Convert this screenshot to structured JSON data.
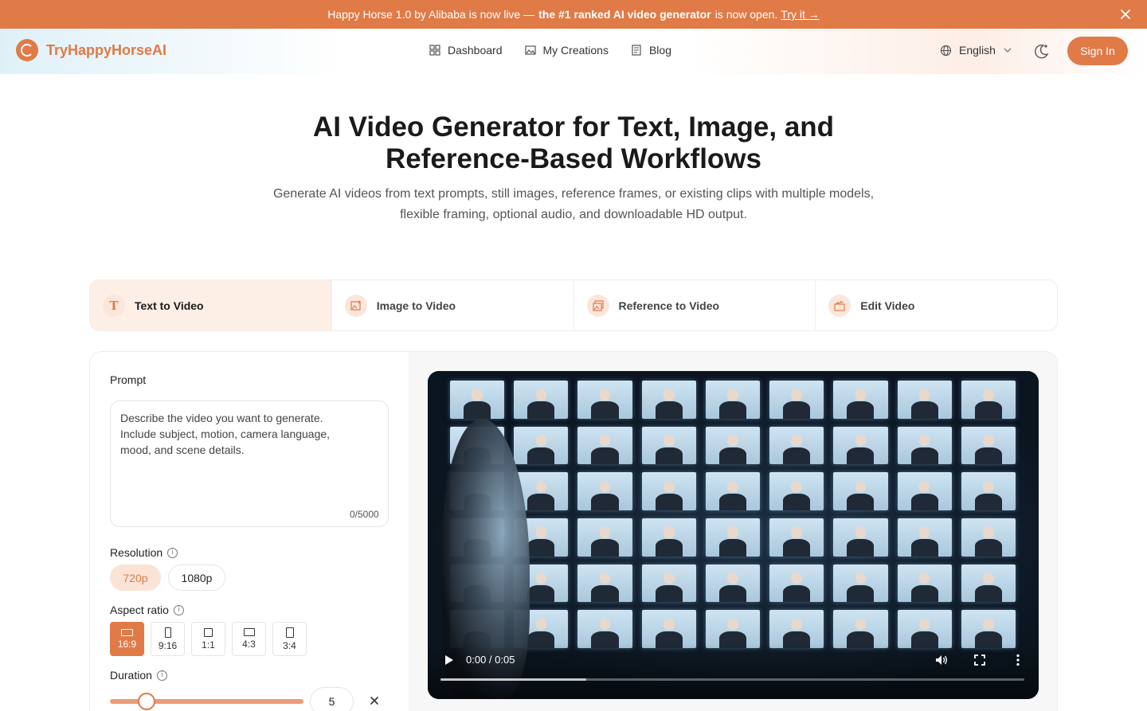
{
  "announcement": {
    "prefix": "Happy Horse 1.0 by Alibaba is now live —",
    "strong": "the #1 ranked AI video generator",
    "suffix": "is now open.",
    "link": "Try it →"
  },
  "header": {
    "brand": "TryHappyHorseAI",
    "nav": [
      {
        "label": "Dashboard",
        "icon": "grid-icon"
      },
      {
        "label": "My Creations",
        "icon": "gallery-icon"
      },
      {
        "label": "Blog",
        "icon": "document-icon"
      }
    ],
    "language": "English",
    "sign_in": "Sign In"
  },
  "hero": {
    "title_line1": "AI Video Generator for Text, Image, and",
    "title_line2": "Reference-Based Workflows",
    "subtitle_line1": "Generate AI videos from text prompts, still images, reference frames, or existing clips with multiple models,",
    "subtitle_line2": "flexible framing, optional audio, and downloadable HD output."
  },
  "tabs": [
    {
      "label": "Text to Video",
      "icon": "text-icon",
      "glyph": "T",
      "active": true
    },
    {
      "label": "Image to Video",
      "icon": "image-plus-icon",
      "glyph": "",
      "active": false
    },
    {
      "label": "Reference to Video",
      "icon": "image-stack-icon",
      "glyph": "",
      "active": false
    },
    {
      "label": "Edit Video",
      "icon": "clapperboard-icon",
      "glyph": "",
      "active": false
    }
  ],
  "form": {
    "prompt_label": "Prompt",
    "prompt_placeholder": "Describe the video you want to generate.\nInclude subject, motion, camera language,\nmood, and scene details.",
    "prompt_value": "",
    "counter": "0/5000",
    "resolution_label": "Resolution",
    "resolutions": [
      "720p",
      "1080p"
    ],
    "resolution_selected": "720p",
    "aspect_label": "Aspect ratio",
    "aspect_ratios": [
      "16:9",
      "9:16",
      "1:1",
      "4:3",
      "3:4"
    ],
    "aspect_selected": "16:9",
    "duration_label": "Duration",
    "duration_value": "5",
    "duration_fraction": 0.19
  },
  "video": {
    "time": "0:00 / 0:05",
    "buffered_fraction": 0.25
  },
  "colors": {
    "accent": "#e07a47",
    "accent_light": "#fbe3d6",
    "tab_active_bg": "#fdeee6"
  }
}
